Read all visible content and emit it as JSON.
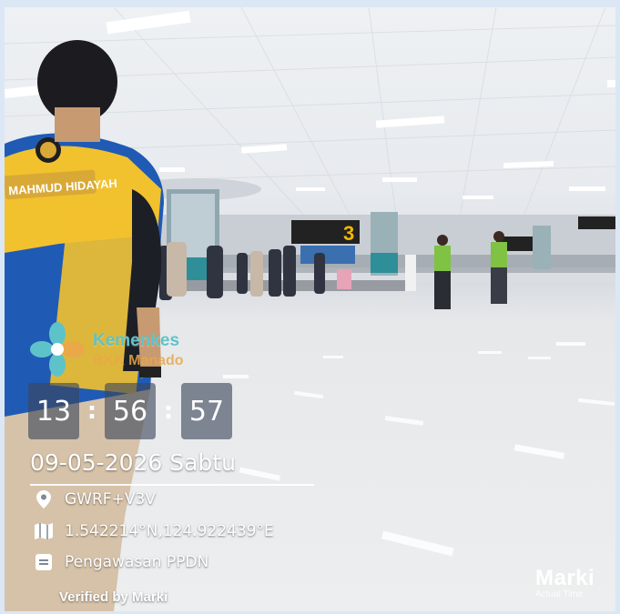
{
  "overlay": {
    "brand_name": "Kemenkes",
    "brand_sub": "BKK Manado",
    "time": {
      "hours": "13",
      "minutes": "56",
      "seconds": "57",
      "separator": ":"
    },
    "date": "09-05-2026 Sabtu",
    "plus_code": "GWRF+V3V",
    "coordinates": "1.542214°N,124.922439°E",
    "note": "Pengawasan PPDN",
    "verified": "Verified by Marki",
    "watermark": {
      "name": "Marki",
      "tagline": "Actual Time"
    }
  },
  "scene": {
    "vest_text": "MAHMUD HIDAYAH",
    "carousel_number": "3",
    "colors": {
      "vest_yellow": "#f2c12e",
      "vest_blue": "#1f5bb5",
      "floor": "#eceeef",
      "ceiling": "#eef1f4",
      "brand_teal": "#5ec3c9",
      "brand_orange": "#e9a84a"
    }
  }
}
